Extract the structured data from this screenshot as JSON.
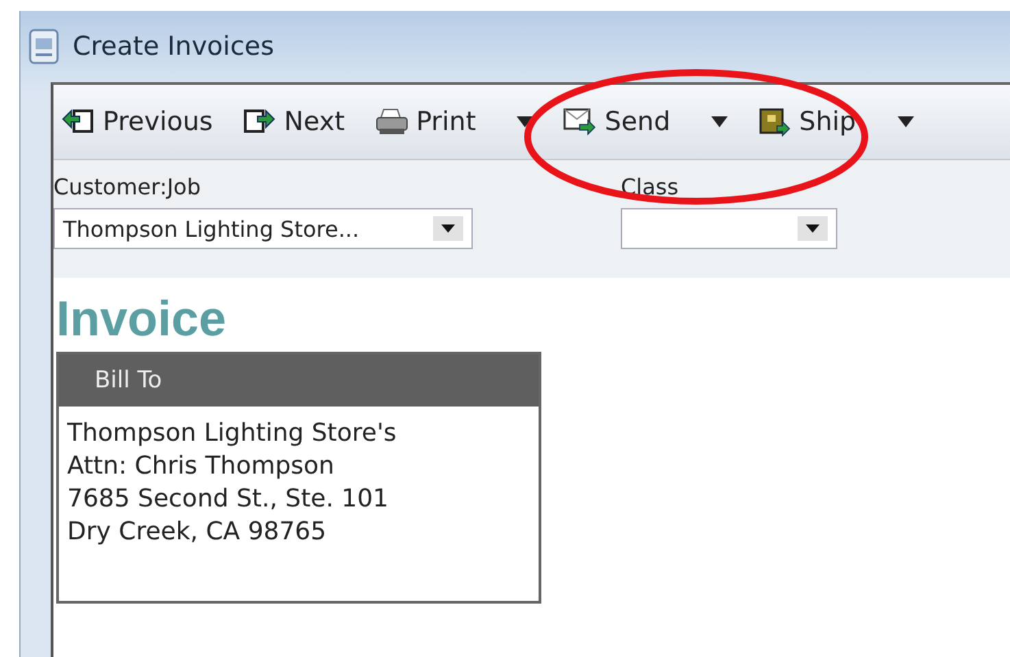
{
  "window": {
    "title": "Create Invoices"
  },
  "toolbar": [
    {
      "label": "Previous",
      "kind": "previous",
      "menu": false
    },
    {
      "label": "Next",
      "kind": "next",
      "menu": false
    },
    {
      "label": "Print",
      "kind": "print",
      "menu": true
    },
    {
      "label": "Send",
      "kind": "send",
      "menu": true
    },
    {
      "label": "Ship",
      "kind": "ship",
      "menu": true
    }
  ],
  "fields": [
    {
      "label": "Customer:Job",
      "value": "Thompson Lighting Store..."
    },
    {
      "label": "Class"
    }
  ],
  "form": {
    "title": "Invoice",
    "bill_to": {
      "heading": "Bill To",
      "lines": [
        "Thompson Lighting Store's",
        "Attn: Chris Thompson",
        "7685 Second St., Ste. 101",
        "Dry Creek, CA 98765"
      ]
    }
  },
  "annotations": [
    {
      "kind": "ellipse",
      "color": "#e8141a"
    }
  ]
}
